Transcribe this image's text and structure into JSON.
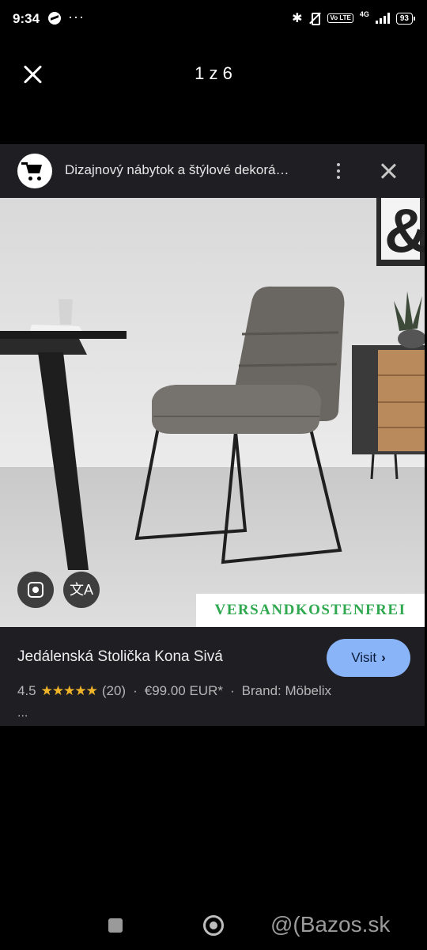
{
  "status_bar": {
    "time": "9:34",
    "notification_dots": "···",
    "network": "4G",
    "volte": "Vo LTE",
    "battery": "93"
  },
  "viewer": {
    "counter": "1 z 6"
  },
  "card": {
    "source_title": "Dizajnový nábytok a štýlové dekorá…",
    "product_title": "Jedálenská Stolička Kona Sivá",
    "visit_label": "Visit",
    "rating": "4.5",
    "stars": "★★★★★",
    "reviews": "(20)",
    "price": "€99.00 EUR*",
    "brand": "Brand: Möbelix",
    "more": "..."
  },
  "image": {
    "watermark": "VERSANDKOSTENFREI",
    "translate_glyph": "文A"
  },
  "footer": {
    "watermark": "@(Bazos.sk"
  },
  "colors": {
    "accent": "#8ab4f8",
    "star": "#f0b429",
    "card_bg": "#1f1f23",
    "watermark_text": "#2fa84f"
  }
}
